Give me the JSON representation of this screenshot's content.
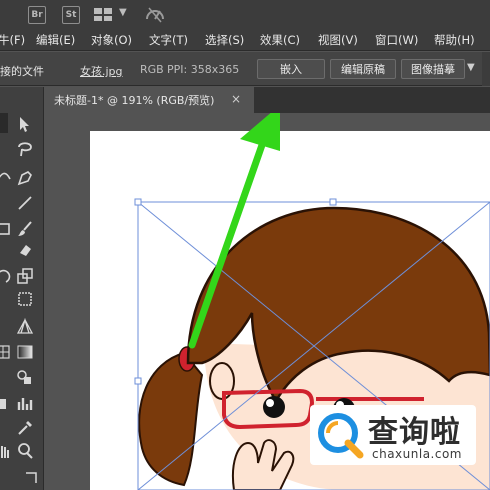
{
  "app_bar": {
    "br_label": "Br",
    "st_label": "St"
  },
  "menu": {
    "items": [
      "牛(F)",
      "编辑(E)",
      "对象(O)",
      "文字(T)",
      "选择(S)",
      "效果(C)",
      "视图(V)",
      "窗口(W)",
      "帮助(H)"
    ]
  },
  "control_bar": {
    "linked_file": "接的文件",
    "file_name": "女孩.jpg",
    "color_mode": "RGB",
    "ppi": "PPI: 358x365",
    "embed_button": "嵌入",
    "edit_original_button": "编辑原稿",
    "image_trace_button": "图像描摹"
  },
  "document_tab": {
    "title": "未标题-1* @ 191% (RGB/预览)",
    "close": "×"
  },
  "watermark": {
    "text": "查询啦",
    "url": "chaxunla.com"
  },
  "colors": {
    "ui_dark": "#3c3c3c",
    "canvas_gray": "#535353",
    "hair_brown": "#7a3a0c",
    "arrow_green": "#33d61a",
    "glasses_red": "#d0222e",
    "selection_blue": "#6e8fd8"
  }
}
